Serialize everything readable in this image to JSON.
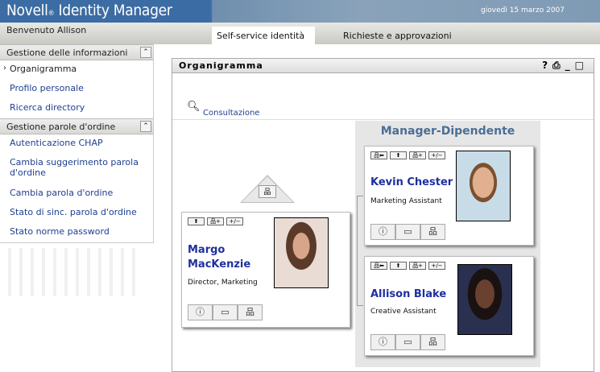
{
  "header": {
    "product": "Novell",
    "reg": "®",
    "app": "Identity Manager",
    "date": "giovedì 15 marzo 2007"
  },
  "welcome": "Benvenuto Allison",
  "tabs": [
    {
      "label": "Self-service identità",
      "active": true
    },
    {
      "label": "Richieste e approvazioni",
      "active": false
    }
  ],
  "sidebar": {
    "sections": [
      {
        "title": "Gestione delle informazioni",
        "items": [
          "Organigramma",
          "Profilo personale",
          "Ricerca directory"
        ]
      },
      {
        "title": "Gestione parole d'ordine",
        "items": [
          "Autenticazione CHAP",
          "Cambia suggerimento parola d'ordine",
          "Cambia parola d'ordine",
          "Stato di sinc. parola d'ordine",
          "Stato norme password"
        ]
      }
    ],
    "collapse": "⌃"
  },
  "panel": {
    "title": "Organigramma",
    "icons": [
      "?",
      "⎙",
      "_",
      "□"
    ],
    "lookup": "Consultazione"
  },
  "group_title": "Manager-Dipendente",
  "cards": [
    {
      "name1": "Margo",
      "name2": "MacKenzie",
      "role": "Director, Marketing"
    },
    {
      "name": "Kevin Chester",
      "role": "Marketing Assistant"
    },
    {
      "name": "Allison Blake",
      "role": "Creative Assistant"
    }
  ],
  "buttons": {
    "up": "⬆",
    "add": "品+",
    "pm": "+/−",
    "mgr": "品⬅",
    "info": "ⓘ",
    "card": "▭",
    "org": "品"
  }
}
